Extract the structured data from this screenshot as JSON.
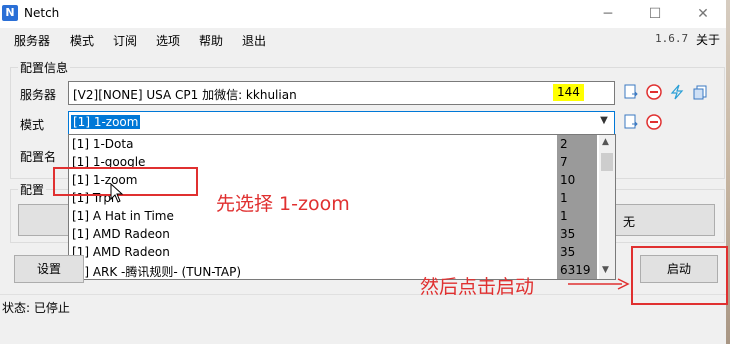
{
  "window": {
    "title": "Netch",
    "minimize_glyph": "─",
    "maximize_glyph": "☐",
    "close_glyph": "✕",
    "icon": "netch-app-icon"
  },
  "menu": {
    "items": [
      "服务器",
      "模式",
      "订阅",
      "选项",
      "帮助",
      "退出"
    ],
    "version": "1.6.7",
    "about": "关于"
  },
  "config": {
    "group_title": "配置信息",
    "server_label": "服务器",
    "server_value": "[V2][NONE] USA CP1 加微信: kkhulian",
    "server_delay": "144",
    "mode_label": "模式",
    "mode_value": "[1] 1-zoom",
    "profile_label": "配置名"
  },
  "profiles": {
    "group_title": "配置",
    "button_suffix": "无"
  },
  "dropdown": {
    "rows": [
      {
        "name": "[1] 1-Dota",
        "count": "2"
      },
      {
        "name": "[1] 1-google",
        "count": "7"
      },
      {
        "name": "[1] 1-zoom",
        "count": "10"
      },
      {
        "name": "[1] Trpl",
        "count": "1"
      },
      {
        "name": "[1] A Hat in Time",
        "count": "1"
      },
      {
        "name": "[1] AMD Radeon",
        "count": "35"
      },
      {
        "name": "[1] AMD Radeon",
        "count": "35"
      },
      {
        "name": "[2] ARK -腾讯规则- (TUN-TAP)",
        "count": "6319"
      }
    ]
  },
  "buttons": {
    "settings": "设置",
    "start": "启动"
  },
  "status": {
    "text": "状态: 已停止"
  },
  "annotations": {
    "choose": "先选择 1-zoom",
    "click_start": "然后点击启动"
  },
  "colors": {
    "accent_red": "#e03030",
    "highlight_yellow": "#ffff00",
    "selection_blue": "#0078d7"
  }
}
